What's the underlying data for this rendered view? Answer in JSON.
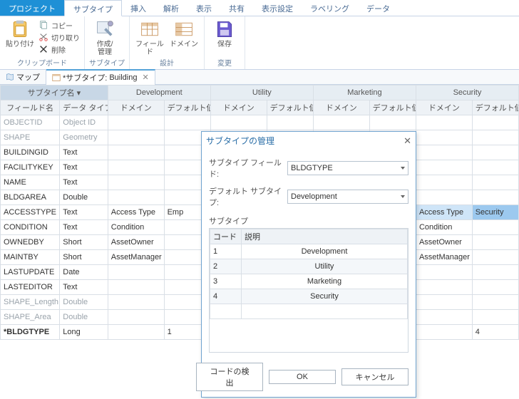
{
  "ribbon": {
    "tabs": [
      "プロジェクト",
      "サブタイプ",
      "挿入",
      "解析",
      "表示",
      "共有",
      "表示設定",
      "ラベリング",
      "データ"
    ],
    "active_tab_idx": 1,
    "project_tab_idx": 0,
    "groups": {
      "clipboard": {
        "label": "クリップボード",
        "paste": "貼り付け",
        "copy": "コピー",
        "cut": "切り取り",
        "delete": "削除"
      },
      "subtype": {
        "label": "サブタイプ",
        "create_manage": "作成/\n管理"
      },
      "design": {
        "label": "設計",
        "field": "フィールド",
        "domain": "ドメイン"
      },
      "changes": {
        "label": "変更",
        "save": "保存"
      }
    }
  },
  "view_tabs": {
    "map": "マップ",
    "subtype_prefix": "*サブタイプ:",
    "subtype_name": "Building"
  },
  "grid": {
    "group_headers": [
      "サブタイプ名 ▾",
      "Development",
      "Utility",
      "Marketing",
      "Security"
    ],
    "col_headers": [
      "フィールド名",
      "データ タイプ",
      "ドメイン",
      "デフォルト値",
      "ドメイン",
      "デフォルト値",
      "ドメイン",
      "デフォルト値",
      "ドメイン",
      "デフォルト値"
    ],
    "rows": [
      {
        "f": "OBJECTID",
        "t": "Object ID",
        "gray": true
      },
      {
        "f": "SHAPE",
        "t": "Geometry",
        "gray": true
      },
      {
        "f": "BUILDINGID",
        "t": "Text"
      },
      {
        "f": "FACILITYKEY",
        "t": "Text"
      },
      {
        "f": "NAME",
        "t": "Text"
      },
      {
        "f": "BLDGAREA",
        "t": "Double"
      },
      {
        "f": "ACCESSTYPE",
        "t": "Text",
        "d1": "Access Type",
        "v1": "Emp",
        "d4": "Access Type",
        "v4": "Security",
        "hl": true
      },
      {
        "f": "CONDITION",
        "t": "Text",
        "d1": "Condition",
        "d4": "Condition"
      },
      {
        "f": "OWNEDBY",
        "t": "Short",
        "d1": "AssetOwner",
        "d4": "AssetOwner"
      },
      {
        "f": "MAINTBY",
        "t": "Short",
        "d1": "AssetManager",
        "d4": "AssetManager"
      },
      {
        "f": "LASTUPDATE",
        "t": "Date"
      },
      {
        "f": "LASTEDITOR",
        "t": "Text"
      },
      {
        "f": "SHAPE_Length",
        "t": "Double",
        "gray": true
      },
      {
        "f": "SHAPE_Area",
        "t": "Double",
        "gray": true
      },
      {
        "f": "*BLDGTYPE",
        "t": "Long",
        "v1": "1",
        "v4": "4",
        "bold": true
      }
    ]
  },
  "dialog": {
    "title": "サブタイプの管理",
    "field_label": "サブタイプ フィールド:",
    "field_value": "BLDGTYPE",
    "default_label": "デフォルト サブタイプ:",
    "default_value": "Development",
    "list_label": "サブタイプ",
    "headers": [
      "コード",
      "説明"
    ],
    "rows": [
      {
        "code": "1",
        "desc": "Development"
      },
      {
        "code": "2",
        "desc": "Utility"
      },
      {
        "code": "3",
        "desc": "Marketing"
      },
      {
        "code": "4",
        "desc": "Security"
      }
    ],
    "detect": "コードの検出",
    "ok": "OK",
    "cancel": "キャンセル"
  }
}
